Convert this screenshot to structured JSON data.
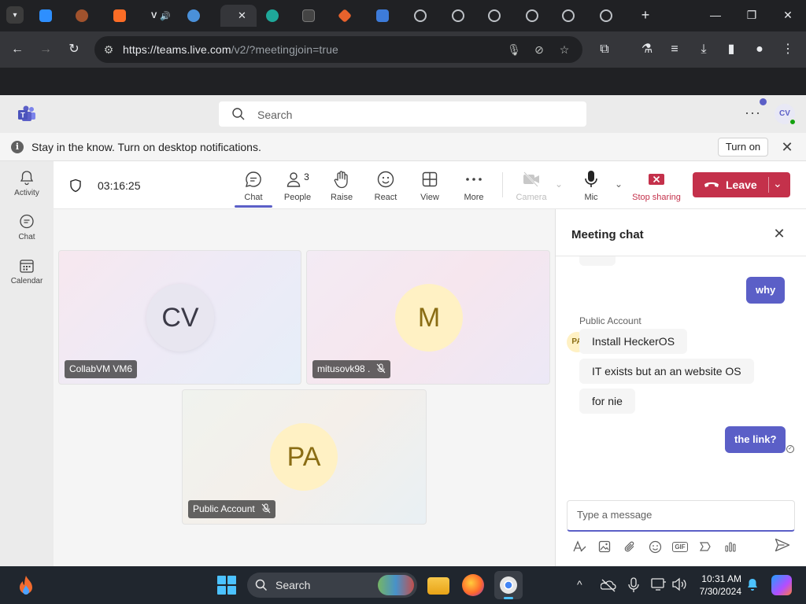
{
  "browser": {
    "url_host": "https://teams.live.com",
    "url_path": "/v2/?meetingjoin=true",
    "tab_labels": [
      "",
      "",
      "",
      "V",
      "",
      "",
      "",
      "",
      "",
      "",
      "",
      "",
      "",
      ""
    ],
    "new_tab": "+",
    "minimize": "—",
    "restore": "❐",
    "close": "✕"
  },
  "teams": {
    "search_placeholder": "Search",
    "more": "···",
    "avatar": "CV",
    "notification": {
      "message": "Stay in the know. Turn on desktop notifications.",
      "turn_on": "Turn on",
      "info": "i",
      "close": "✕"
    },
    "rail": [
      {
        "label": "Activity"
      },
      {
        "label": "Chat"
      },
      {
        "label": "Calendar"
      }
    ]
  },
  "meeting": {
    "timer": "03:16:25",
    "people_count": "3",
    "buttons": {
      "chat": "Chat",
      "people": "People",
      "raise": "Raise",
      "react": "React",
      "view": "View",
      "more": "More",
      "camera": "Camera",
      "mic": "Mic",
      "stop_sharing": "Stop sharing"
    },
    "leave": "Leave",
    "participants": [
      {
        "initials": "CV",
        "name": "CollabVM VM6"
      },
      {
        "initials": "M",
        "name": "mitusovk98 ."
      },
      {
        "initials": "PA",
        "name": "Public Account"
      }
    ]
  },
  "chat": {
    "title": "Meeting chat",
    "close": "✕",
    "messages": [
      {
        "from": "me",
        "text": "why"
      },
      {
        "from": "Public Account",
        "initials": "PA",
        "text": "Install HeckerOS"
      },
      {
        "from": "Public Account",
        "text": "IT exists but an an website OS"
      },
      {
        "from": "Public Account",
        "text": "for nie"
      },
      {
        "from": "me",
        "text": "the link?"
      }
    ],
    "compose_placeholder": "Type a message",
    "gif": "GIF"
  },
  "taskbar": {
    "search_placeholder": "Search",
    "time": "10:31 AM",
    "date": "7/30/2024",
    "tray_expand": "^"
  },
  "colors": {
    "teams_purple": "#5b5fc7",
    "leave_red": "#c4314b",
    "mb_bg": "#ffffff"
  }
}
